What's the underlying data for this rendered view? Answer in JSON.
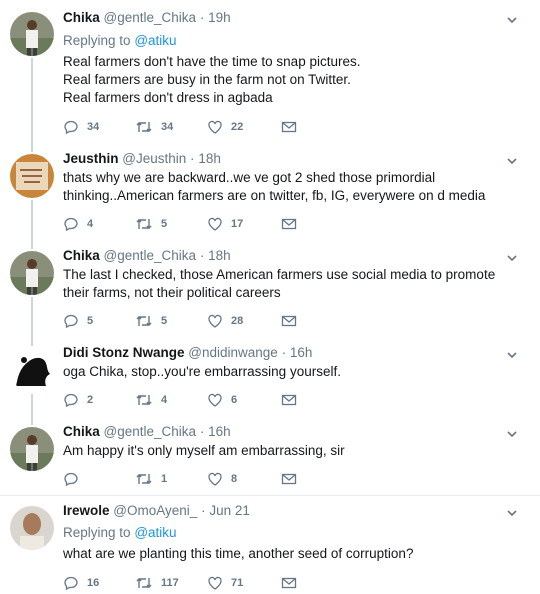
{
  "tweets": [
    {
      "name": "Chika",
      "handle": "@gentle_Chika",
      "time": "19h",
      "reply_prefix": "Replying to",
      "reply_handle": "@atiku",
      "lines": [
        "Real farmers don't have the time to snap pictures.",
        "Real farmers are busy in the farm not on Twitter.",
        "Real farmers don't dress in agbada"
      ],
      "replies": "34",
      "retweets": "34",
      "likes": "22",
      "avatar": "person-standing-photo"
    },
    {
      "name": "Jeusthin",
      "handle": "@Jeusthin",
      "time": "18h",
      "lines": [
        "thats why we are backward..we ve got 2 shed those primordial",
        "thinking..American farmers are on twitter, fb, IG, everywere on d media"
      ],
      "replies": "4",
      "retweets": "5",
      "likes": "17",
      "avatar": "handwritten-note-photo"
    },
    {
      "name": "Chika",
      "handle": "@gentle_Chika",
      "time": "18h",
      "lines": [
        "The last I checked, those American farmers use social media to promote",
        "their farms, not their political careers"
      ],
      "replies": "5",
      "retweets": "5",
      "likes": "28",
      "avatar": "person-standing-photo"
    },
    {
      "name": "Didi Stonz Nwange",
      "handle": "@ndidinwange",
      "time": "16h",
      "lines": [
        "oga Chika, stop..you're embarrassing yourself."
      ],
      "replies": "2",
      "retweets": "4",
      "likes": "6",
      "avatar": "black-silhouette"
    },
    {
      "name": "Chika",
      "handle": "@gentle_Chika",
      "time": "16h",
      "lines": [
        "Am happy it's only myself am embarrassing, sir"
      ],
      "replies": "",
      "retweets": "1",
      "likes": "8",
      "avatar": "person-standing-photo"
    },
    {
      "name": "Irewole",
      "handle": "@OmoAyeni_",
      "time": "Jun 21",
      "reply_prefix": "Replying to",
      "reply_handle": "@atiku",
      "lines": [
        "what are we planting this time, another seed of corruption?"
      ],
      "replies": "16",
      "retweets": "117",
      "likes": "71",
      "avatar": "portrait-photo"
    }
  ],
  "separator": "·",
  "colors": {
    "accent": "#1b95e0",
    "muted": "#657786",
    "text": "#14171a",
    "thread": "#ccd6dd"
  }
}
